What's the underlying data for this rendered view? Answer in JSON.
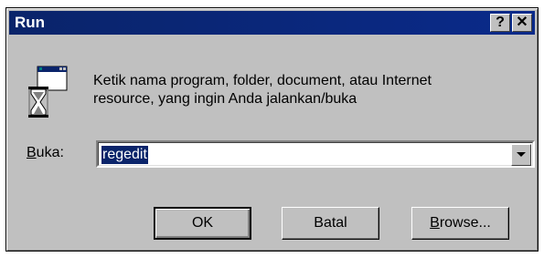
{
  "window": {
    "title": "Run",
    "help_label": "?",
    "close_label": "✕"
  },
  "description": {
    "line1": "Ketik nama program, folder, document, atau Internet",
    "line2": "resource, yang ingin Anda jalankan/buka"
  },
  "open_field": {
    "label_accel": "B",
    "label_rest": "uka:",
    "value": "regedit"
  },
  "buttons": {
    "ok": "OK",
    "cancel": "Batal",
    "browse_accel": "B",
    "browse_rest": "rowse..."
  },
  "icons": {
    "run": "run-program-icon",
    "dropdown": "dropdown-arrow-icon"
  }
}
